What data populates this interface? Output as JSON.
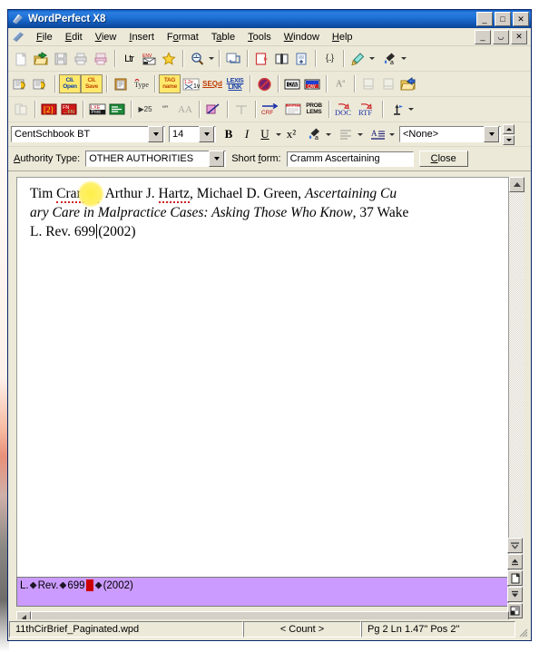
{
  "window": {
    "title": "WordPerfect X8",
    "app_icon": "wordperfect-pen-icon",
    "controls": {
      "minimize": "_",
      "maximize": "□",
      "close": "✕"
    },
    "doc_controls": {
      "minimize": "_",
      "restore": "❐",
      "close": "✕"
    }
  },
  "menu": {
    "items": [
      {
        "label": "File",
        "accel": "F"
      },
      {
        "label": "Edit",
        "accel": "E"
      },
      {
        "label": "View",
        "accel": "V"
      },
      {
        "label": "Insert",
        "accel": "I"
      },
      {
        "label": "Format",
        "accel": "o"
      },
      {
        "label": "Table",
        "accel": "a"
      },
      {
        "label": "Tools",
        "accel": "T"
      },
      {
        "label": "Window",
        "accel": "W"
      },
      {
        "label": "Help",
        "accel": "H"
      }
    ]
  },
  "toolbar_main": {
    "buttons": [
      {
        "name": "new-document-icon",
        "label": "New",
        "disabled": true
      },
      {
        "name": "open-document-icon",
        "label": "Open",
        "disabled": false
      },
      {
        "name": "save-document-icon",
        "label": "Save",
        "disabled": true
      },
      {
        "name": "print-icon",
        "label": "Print",
        "disabled": true
      },
      {
        "name": "print-preview-icon",
        "label": "Print Preview",
        "disabled": true
      },
      {
        "name": "letter-format-icon",
        "label": "Ltr",
        "disabled": false
      },
      {
        "name": "envelope-icon",
        "label": "ENV",
        "disabled": false
      },
      {
        "name": "favorites-star-icon",
        "label": "Favorites",
        "disabled": false
      },
      {
        "name": "zoom-icon",
        "label": "Zoom",
        "disabled": false
      },
      {
        "name": "page-view-icon",
        "label": "Page View",
        "disabled": false
      },
      {
        "name": "new-page-icon",
        "label": "New Page",
        "disabled": false
      },
      {
        "name": "two-page-view-icon",
        "label": "Two Page",
        "disabled": false
      },
      {
        "name": "insert-page-icon",
        "label": "Insert Page",
        "disabled": false
      },
      {
        "name": "bracket-codes-icon",
        "label": "[...]",
        "disabled": false
      },
      {
        "name": "highlighter-icon",
        "label": "Highlight",
        "disabled": false
      },
      {
        "name": "font-color-icon",
        "label": "Font Color",
        "disabled": false
      }
    ]
  },
  "toolbar_legal": {
    "buttons": [
      {
        "name": "client-folder-open-icon",
        "label": "Open Client"
      },
      {
        "name": "client-folder-save-icon",
        "label": "Save Client"
      },
      {
        "name": "cli-open-icon",
        "label": "Cli. Open"
      },
      {
        "name": "cli-save-icon",
        "label": "Cli. Save"
      },
      {
        "name": "clipboard-icon",
        "label": "Clipboard"
      },
      {
        "name": "type-icon",
        "label": "Type"
      },
      {
        "name": "tag-icon",
        "label": "Tag"
      },
      {
        "name": "format-1v2-icon",
        "label": "1v2"
      },
      {
        "name": "seqd-icon",
        "label": "SEQd"
      },
      {
        "name": "lexis-link-icon",
        "label": "LEXIS LINK"
      },
      {
        "name": "no-symbol-icon",
        "label": "Disable"
      },
      {
        "name": "qw-icon",
        "label": "QW"
      },
      {
        "name": "qw-blue-icon",
        "label": "QW Blue"
      },
      {
        "name": "superscript-icon",
        "label": "Superscript",
        "disabled": true
      },
      {
        "name": "page-left-icon",
        "label": "Page Left",
        "disabled": true
      },
      {
        "name": "page-right-icon",
        "label": "Page Right",
        "disabled": true
      },
      {
        "name": "open-folder-blue-icon",
        "label": "Open Folder"
      }
    ]
  },
  "toolbar_tools": {
    "buttons": [
      {
        "name": "document-compare-icon",
        "label": "Compare",
        "disabled": true
      },
      {
        "name": "bracket-2-icon",
        "label": "[2]"
      },
      {
        "name": "footnote-convert-icon",
        "label": "FN→FN"
      },
      {
        "name": "lexe-print-icon",
        "label": "LXE Print"
      },
      {
        "name": "green-lines-icon",
        "label": "Lines"
      },
      {
        "name": "section-25-icon",
        "label": "25"
      },
      {
        "name": "quotes-icon",
        "label": "Quotes"
      },
      {
        "name": "double-a-icon",
        "label": "AA",
        "disabled": true
      },
      {
        "name": "cut-link-icon",
        "label": "Cut Link"
      },
      {
        "name": "table-format-icon",
        "label": "Table Format",
        "disabled": true
      },
      {
        "name": "crf-icon",
        "label": "CRF"
      },
      {
        "name": "draft-icon",
        "label": "Draft"
      },
      {
        "name": "problems-icon",
        "label": "PROB LEMS"
      },
      {
        "name": "doc-export-icon",
        "label": "DOC"
      },
      {
        "name": "rtf-export-icon",
        "label": "RTF"
      },
      {
        "name": "merge-icon",
        "label": "Merge"
      }
    ]
  },
  "property_bar": {
    "font_name": "CentSchbook BT",
    "font_size": "14",
    "bold": "B",
    "italic": "I",
    "underline": "U",
    "superscript": "x²",
    "highlight": "Highlight",
    "alignment": "Alignment",
    "text_style": "Text Style",
    "style_value": "<None>"
  },
  "authority_bar": {
    "type_label": "Authority Type:",
    "type_label_accel": "A",
    "type_value": "OTHER AUTHORITIES",
    "short_form_label": "Short form:",
    "short_form_label_accel": "f",
    "short_form_value": "Cramm Ascertaining",
    "close_label": "Close",
    "close_accel": "C"
  },
  "document": {
    "line1_pre": "Tim ",
    "line1_sq1": "Cramm",
    "line1_mid": ", Arthur J. ",
    "line1_sq2": "Hartz",
    "line1_post": ", Michael D. Green, ",
    "line1_italic": "Ascertaining Cu",
    "line2_italic": "ary Care in Malpractice Cases: Asking Those Who Know",
    "line2_post": ", 37 Wake",
    "line3_pre": "L. Rev. 699",
    "line3_post": "(2002)"
  },
  "reveal_codes": {
    "text_before": "L.",
    "text_mid": "Rev.",
    "text_num": "699",
    "text_after": "(2002)"
  },
  "page_nav": {
    "buttons": [
      {
        "name": "scroll-down-fast-icon",
        "label": "Scroll Down"
      },
      {
        "name": "previous-page-icon",
        "label": "Previous Page"
      },
      {
        "name": "page-icon",
        "label": "Page"
      },
      {
        "name": "next-page-icon",
        "label": "Next Page"
      },
      {
        "name": "quickfinder-icon",
        "label": "QuickFinder"
      }
    ]
  },
  "status_bar": {
    "filename": "11thCirBrief_Paginated.wpd",
    "count": "< Count >",
    "position": "Pg 2 Ln 1.47\" Pos 2\""
  },
  "colors": {
    "title_blue": "#1257b4",
    "face": "#ece9d8",
    "reveal_purple": "#cb9bff",
    "caret_red": "#cc0000",
    "highlight_yellow": "#ffef4a"
  }
}
